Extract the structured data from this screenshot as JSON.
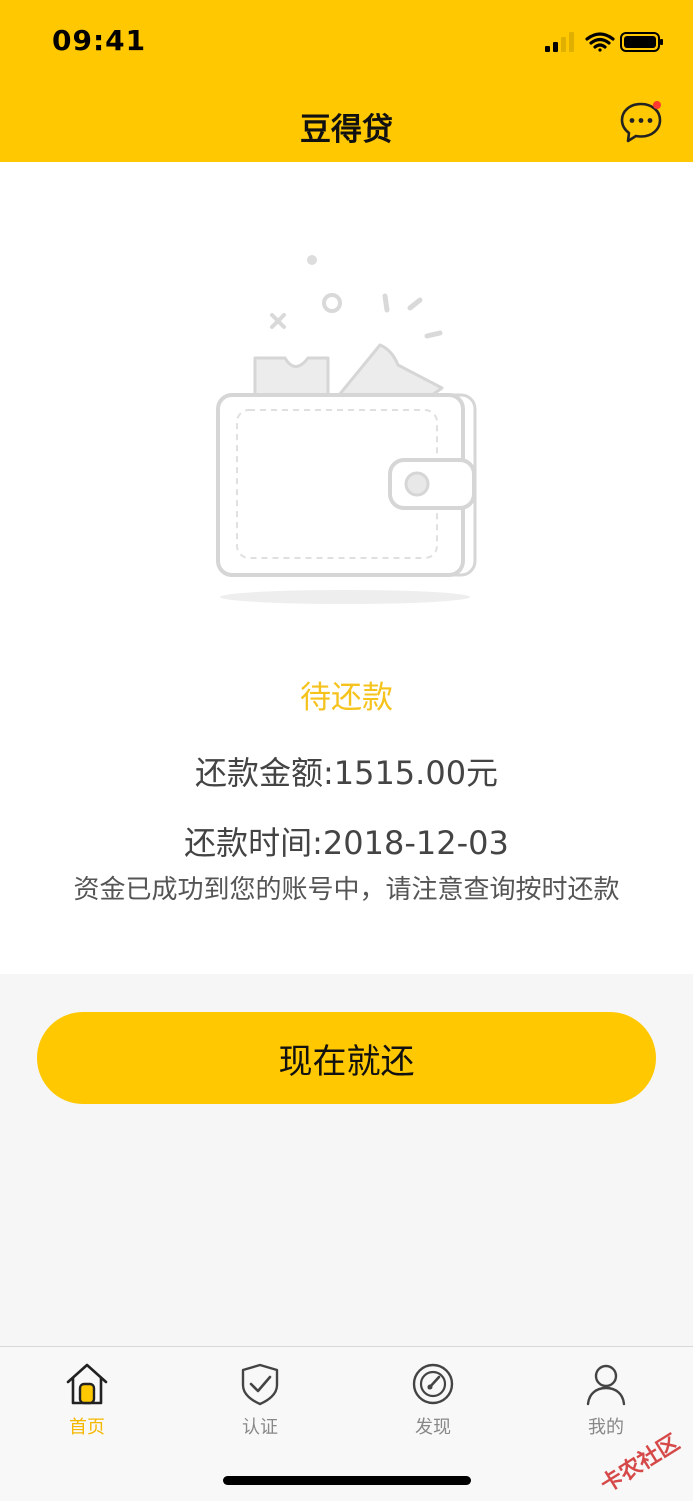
{
  "status_bar": {
    "time": "09:41"
  },
  "header": {
    "title": "豆得贷",
    "message_icon": "chat-bubble-icon"
  },
  "loan": {
    "status": "待还款",
    "amount": "还款金额:1515.00元",
    "due_date": "还款时间:2018-12-03",
    "notice": "资金已成功到您的账号中，请注意查询按时还款"
  },
  "actions": {
    "repay_label": "现在就还"
  },
  "tabs": [
    {
      "label": "首页",
      "icon": "home-icon",
      "active": true
    },
    {
      "label": "认证",
      "icon": "shield-check-icon",
      "active": false
    },
    {
      "label": "发现",
      "icon": "compass-icon",
      "active": false
    },
    {
      "label": "我的",
      "icon": "person-icon",
      "active": false
    }
  ],
  "watermark": "卡农社区",
  "colors": {
    "accent": "#ffc801",
    "status_text": "#f6c31c",
    "tab_active": "#f5b800"
  }
}
